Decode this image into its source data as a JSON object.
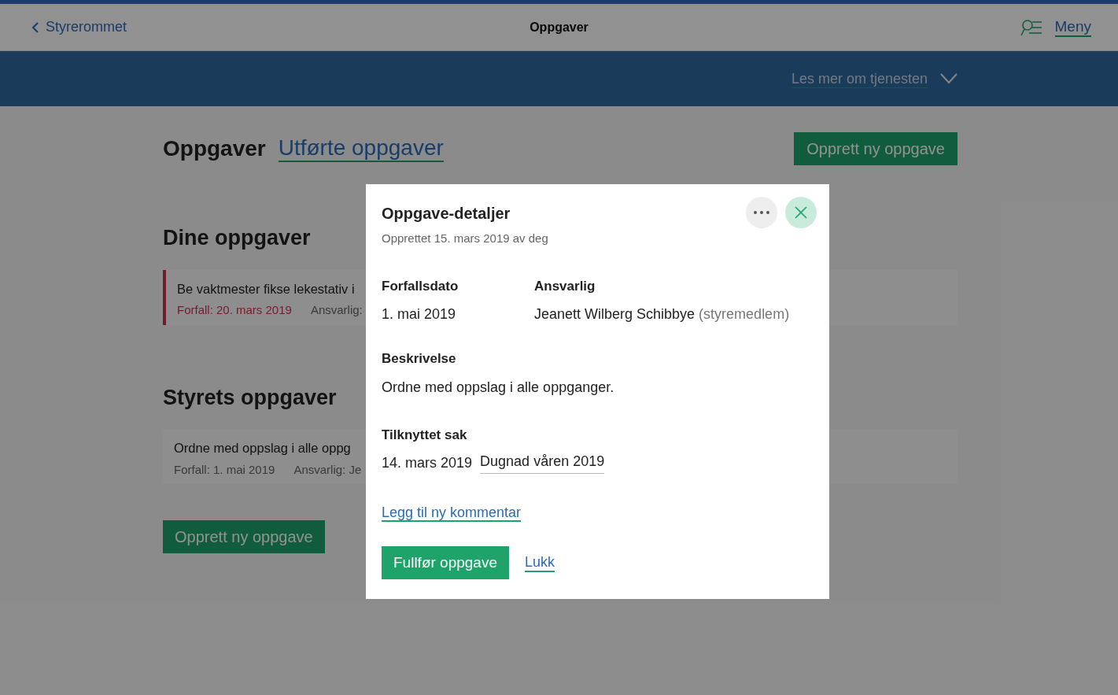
{
  "header": {
    "back_link": "Styrerommet",
    "title": "Oppgaver",
    "menu_link": "Meny"
  },
  "info_band": {
    "link": "Les mer om tjenesten",
    "expanded": false
  },
  "tabs": [
    {
      "label": "Oppgaver",
      "selected": true
    },
    {
      "label": "Utførte oppgaver",
      "selected": false
    }
  ],
  "create_button_top": "Opprett ny oppgave",
  "sections": [
    {
      "heading": "Dine oppgaver",
      "tasks": [
        {
          "title": "Be vaktmester fikse lekestativ i",
          "due": "Forfall: 20. mars 2019",
          "responsible": "Ansvarlig:",
          "overdue": true
        }
      ]
    },
    {
      "heading": "Styrets oppgaver",
      "tasks": [
        {
          "title": "Ordne med oppslag i alle oppg",
          "due": "Forfall: 1. mai 2019",
          "responsible": "Ansvarlig: Je",
          "overdue": false
        }
      ]
    }
  ],
  "create_button_bottom": "Opprett ny oppgave",
  "dialog": {
    "title": "Oppgave-detaljer",
    "subtitle": "Opprettet 15. mars 2019 av deg",
    "due_label": "Forfallsdato",
    "due_value": "1. mai 2019",
    "responsible_label": "Ansvarlig",
    "responsible_name": "Jeanett Wilberg Schibbye",
    "responsible_role": "(styremedlem)",
    "description_label": "Beskrivelse",
    "description": "Ordne med oppslag i alle oppganger.",
    "case_label": "Tilknyttet sak",
    "case_date": "14. mars 2019",
    "case_link": "Dugnad våren 2019",
    "comment_link": "Legg til ny kommentar",
    "complete_button": "Fullfør oppgave",
    "close_link": "Lukk"
  }
}
